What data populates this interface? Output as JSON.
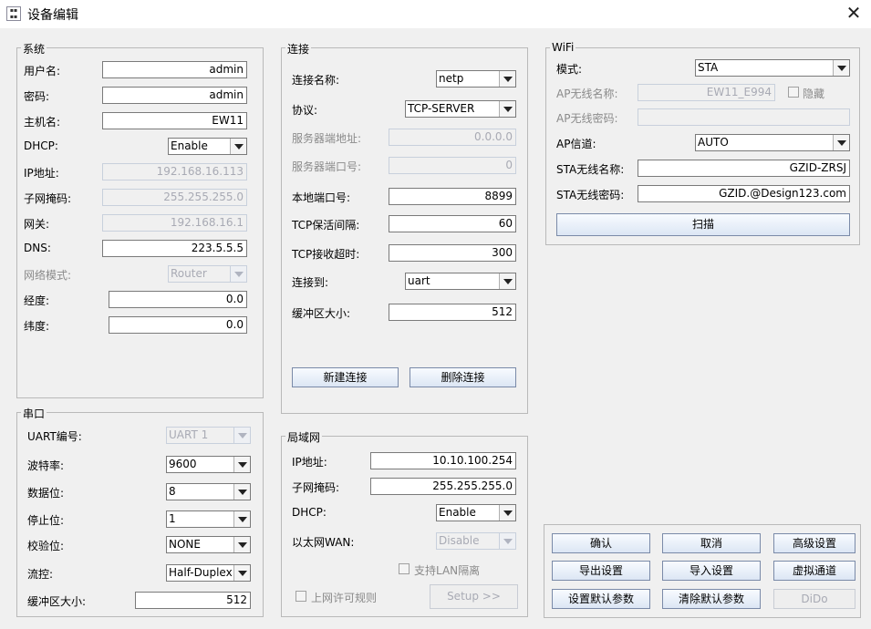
{
  "window": {
    "title": "设备编辑",
    "icon": "app-logo-icon",
    "close_icon": "close-icon"
  },
  "system": {
    "title": "系统",
    "username": {
      "label": "用户名:",
      "value": "admin"
    },
    "password": {
      "label": "密码:",
      "value": "admin"
    },
    "hostname": {
      "label": "主机名:",
      "value": "EW11"
    },
    "dhcp": {
      "label": "DHCP:",
      "value": "Enable"
    },
    "ip": {
      "label": "IP地址:",
      "value": "192.168.16.113"
    },
    "mask": {
      "label": "子网掩码:",
      "value": "255.255.255.0"
    },
    "gateway": {
      "label": "网关:",
      "value": "192.168.16.1"
    },
    "dns": {
      "label": "DNS:",
      "value": "223.5.5.5"
    },
    "netmode": {
      "label": "网络模式:",
      "value": "Router"
    },
    "longitude": {
      "label": "经度:",
      "value": "0.0"
    },
    "latitude": {
      "label": "纬度:",
      "value": "0.0"
    }
  },
  "connection": {
    "title": "连接",
    "name": {
      "label": "连接名称:",
      "value": "netp"
    },
    "protocol": {
      "label": "协议:",
      "value": "TCP-SERVER"
    },
    "server_addr": {
      "label": "服务器端地址:",
      "value": "0.0.0.0"
    },
    "server_port": {
      "label": "服务器端口号:",
      "value": "0"
    },
    "local_port": {
      "label": "本地端口号:",
      "value": "8899"
    },
    "keepalive": {
      "label": "TCP保活间隔:",
      "value": "60"
    },
    "recv_timeout": {
      "label": "TCP接收超时:",
      "value": "300"
    },
    "connect_to": {
      "label": "连接到:",
      "value": "uart"
    },
    "buffer": {
      "label": "缓冲区大小:",
      "value": "512"
    },
    "new_button": "新建连接",
    "delete_button": "删除连接"
  },
  "wifi": {
    "title": "WiFi",
    "mode": {
      "label": "模式:",
      "value": "STA"
    },
    "ap_ssid": {
      "label": "AP无线名称:",
      "value": "EW11_E994"
    },
    "hide": "隐藏",
    "ap_password": {
      "label": "AP无线密码:",
      "value": ""
    },
    "ap_channel": {
      "label": "AP信道:",
      "value": "AUTO"
    },
    "sta_ssid": {
      "label": "STA无线名称:",
      "value": "GZID-ZRSJ"
    },
    "sta_password": {
      "label": "STA无线密码:",
      "value": "GZID.@Design123.com"
    },
    "scan_button": "扫描"
  },
  "serial": {
    "title": "串口",
    "uart": {
      "label": "UART编号:",
      "value": "UART 1"
    },
    "baud": {
      "label": "波特率:",
      "value": "9600"
    },
    "databits": {
      "label": "数据位:",
      "value": "8"
    },
    "stopbits": {
      "label": "停止位:",
      "value": "1"
    },
    "parity": {
      "label": "校验位:",
      "value": "NONE"
    },
    "flow": {
      "label": "流控:",
      "value": "Half-Duplex"
    },
    "buffer": {
      "label": "缓冲区大小:",
      "value": "512"
    }
  },
  "lan": {
    "title": "局域网",
    "ip": {
      "label": "IP地址:",
      "value": "10.10.100.254"
    },
    "mask": {
      "label": "子网掩码:",
      "value": "255.255.255.0"
    },
    "dhcp": {
      "label": "DHCP:",
      "value": "Enable"
    },
    "wan": {
      "label": "以太网WAN:",
      "value": "Disable"
    },
    "lan_isolation": "支持LAN隔离",
    "access_rules": "上网许可规则",
    "setup_button": "Setup >>"
  },
  "actions": {
    "ok": "确认",
    "cancel": "取消",
    "advanced": "高级设置",
    "export": "导出设置",
    "import": "导入设置",
    "virtual_channel": "虚拟通道",
    "set_default": "设置默认参数",
    "clear_default": "清除默认参数",
    "dido": "DiDo"
  }
}
